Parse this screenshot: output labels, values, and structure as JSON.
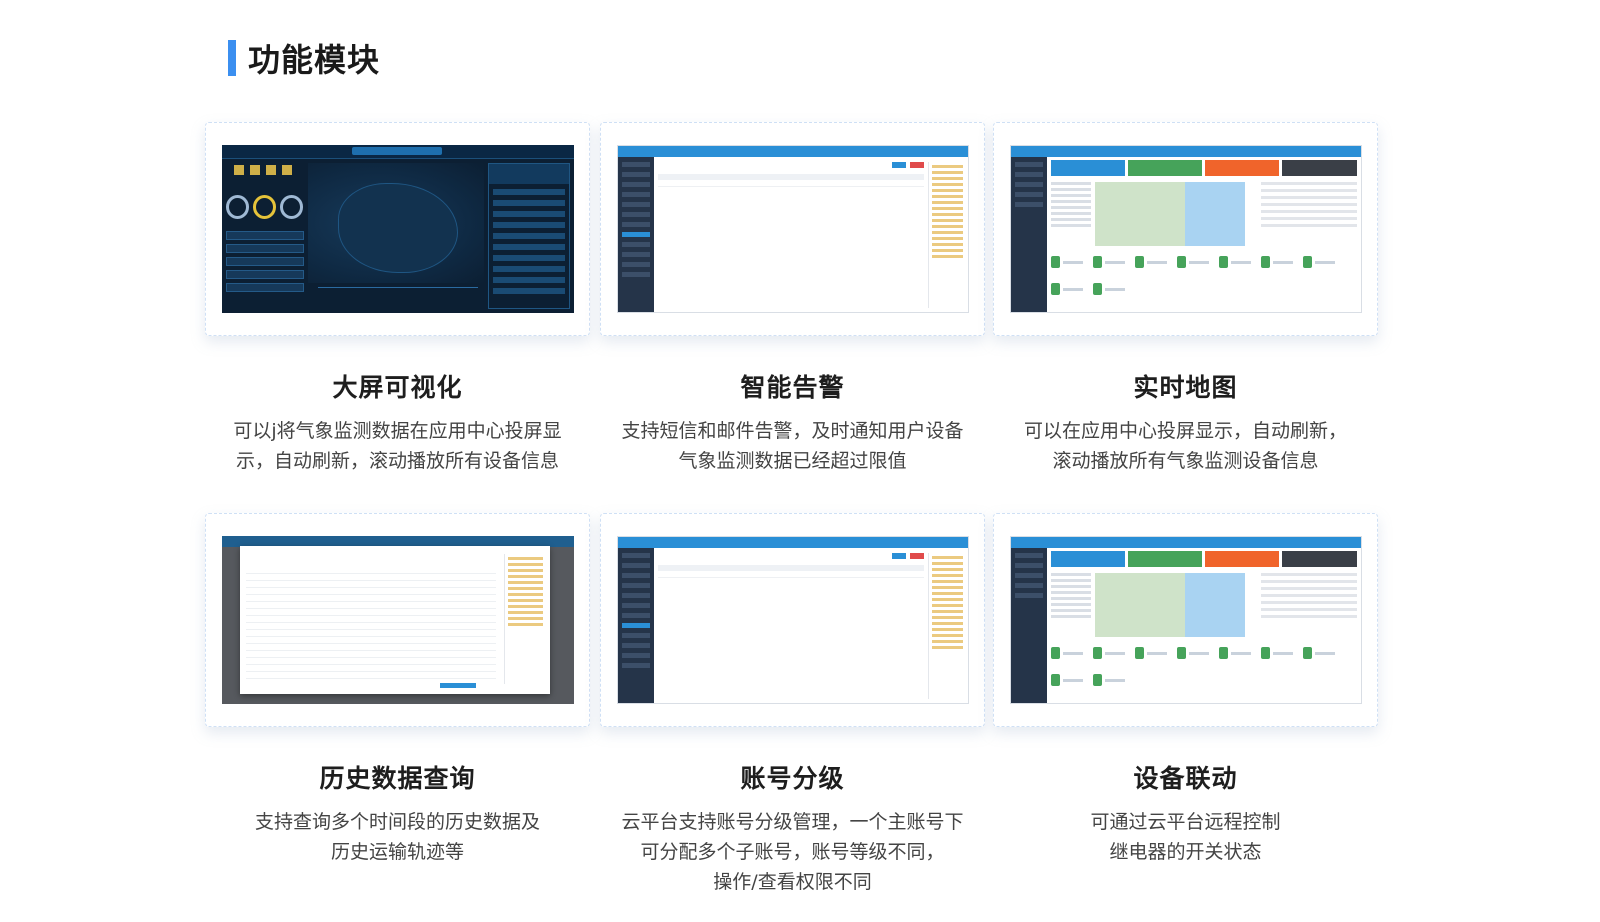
{
  "section": {
    "title": "功能模块",
    "accent_color": "#3b8ff0"
  },
  "cards": [
    {
      "title": "大屏可视化",
      "desc": "可以j将气象监测数据在应用中心投屏显\n示，自动刷新，滚动播放所有设备信息"
    },
    {
      "title": "智能告警",
      "desc": "支持短信和邮件告警，及时通知用户设备\n气象监测数据已经超过限值"
    },
    {
      "title": "实时地图",
      "desc": "可以在应用中心投屏显示，自动刷新，\n滚动播放所有气象监测设备信息"
    },
    {
      "title": "历史数据查询",
      "desc": "支持查询多个时间段的历史数据及\n历史运输轨迹等"
    },
    {
      "title": "账号分级",
      "desc": "云平台支持账号分级管理，一个主账号下\n可分配多个子账号，账号等级不同，\n操作/查看权限不同"
    },
    {
      "title": "设备联动",
      "desc": "可通过云平台远程控制\n继电器的开关状态"
    }
  ],
  "tile_colors": [
    "#2a8fd6",
    "#46a35a",
    "#f0642b",
    "#3a3f47"
  ]
}
